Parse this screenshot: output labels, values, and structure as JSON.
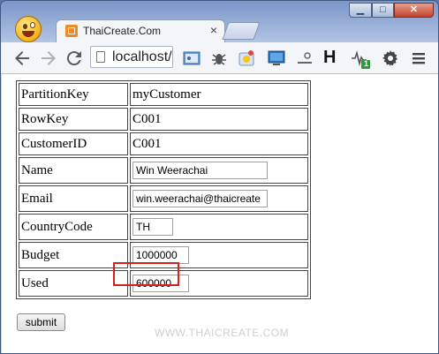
{
  "browser": {
    "tab_title": "ThaiCreate.Com",
    "tab_close": "×",
    "url": "localhost/",
    "window_buttons": {
      "minimize": "▁",
      "maximize": "□",
      "close": "✕"
    },
    "nav_icons": [
      "back-arrow-icon",
      "forward-arrow-icon",
      "reload-icon",
      "page-icon"
    ],
    "extension_icons": [
      "picture-icon",
      "bug-icon",
      "ducky-icon",
      "screen-icon",
      "gear-line-icon",
      "h-icon",
      "pulse-badge-icon",
      "settings-gear-icon",
      "menu-icon"
    ],
    "ext_h": "H",
    "ext_badge": "1"
  },
  "form": {
    "rows": [
      {
        "label": "PartitionKey",
        "value": "myCustomer"
      },
      {
        "label": "RowKey",
        "value": "C001"
      },
      {
        "label": "CustomerID",
        "value": "C001"
      }
    ],
    "inputs": [
      {
        "label": "Name",
        "value": "Win Weerachai"
      },
      {
        "label": "Email",
        "value": "win.weerachai@thaicreate"
      },
      {
        "label": "CountryCode",
        "value": "TH"
      },
      {
        "label": "Budget",
        "value": "1000000"
      },
      {
        "label": "Used",
        "value": "600000"
      }
    ],
    "submit_label": "submit"
  },
  "watermark": "WWW.THAICREATE.COM",
  "colors": {
    "highlight": "#d91e1e",
    "tab_favicon": "#f08a24"
  }
}
